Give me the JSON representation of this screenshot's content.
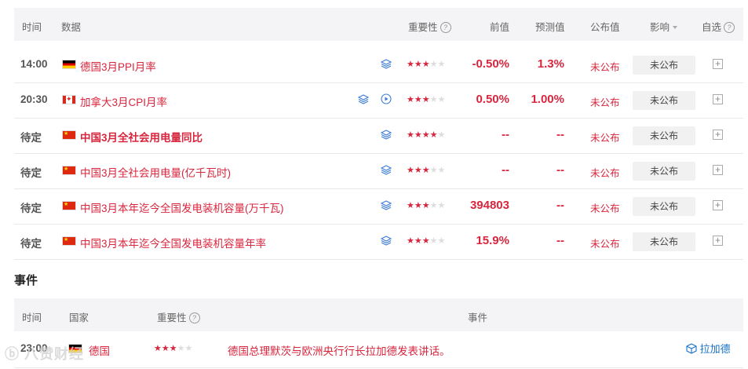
{
  "header": {
    "time": "时间",
    "data": "数据",
    "importance": "重要性",
    "previous": "前值",
    "forecast": "预测值",
    "actual": "公布值",
    "impact": "影响",
    "watch": "自选"
  },
  "rows": [
    {
      "time": "14:00",
      "flag": "germany",
      "name": "德国3月PPI月率",
      "stars": 3,
      "previous": "-0.50%",
      "forecast": "1.3%",
      "actual": "未公布",
      "impact": "未公布",
      "bold": false,
      "video": false
    },
    {
      "time": "20:30",
      "flag": "canada",
      "name": "加拿大3月CPI月率",
      "stars": 3,
      "previous": "0.50%",
      "forecast": "1.00%",
      "actual": "未公布",
      "impact": "未公布",
      "bold": false,
      "video": true
    },
    {
      "time": "待定",
      "flag": "china",
      "name": "中国3月全社会用电量同比",
      "stars": 4,
      "previous": "--",
      "forecast": "--",
      "actual": "未公布",
      "impact": "未公布",
      "bold": true,
      "video": false
    },
    {
      "time": "待定",
      "flag": "china",
      "name": "中国3月全社会用电量(亿千瓦时)",
      "stars": 3,
      "previous": "--",
      "forecast": "--",
      "actual": "未公布",
      "impact": "未公布",
      "bold": false,
      "video": false
    },
    {
      "time": "待定",
      "flag": "china",
      "name": "中国3月本年迄今全国发电装机容量(万千瓦)",
      "stars": 3,
      "previous": "394803",
      "forecast": "--",
      "actual": "未公布",
      "impact": "未公布",
      "bold": false,
      "video": false
    },
    {
      "time": "待定",
      "flag": "china",
      "name": "中国3月本年迄今全国发电装机容量年率",
      "stars": 3,
      "previous": "15.9%",
      "forecast": "--",
      "actual": "未公布",
      "impact": "未公布",
      "bold": false,
      "video": false
    }
  ],
  "events": {
    "section_title": "事件",
    "header": {
      "time": "时间",
      "country": "国家",
      "importance": "重要性",
      "event": "事件"
    },
    "rows": [
      {
        "time": "23:00",
        "flag": "germany",
        "country": "德国",
        "stars": 3,
        "event": "德国总理默茨与欧洲央行行长拉加德发表讲话。",
        "person": "拉加德"
      }
    ]
  },
  "watermark": "八赞财经",
  "colors": {
    "accent": "#d7263d",
    "header_bg": "#f4f4f6",
    "link": "#1a73c8"
  },
  "icons": {
    "layers": "layers-icon",
    "play": "play-circle-icon",
    "help": "question-circle-icon",
    "add": "plus-square-icon",
    "cube": "cube-icon"
  }
}
